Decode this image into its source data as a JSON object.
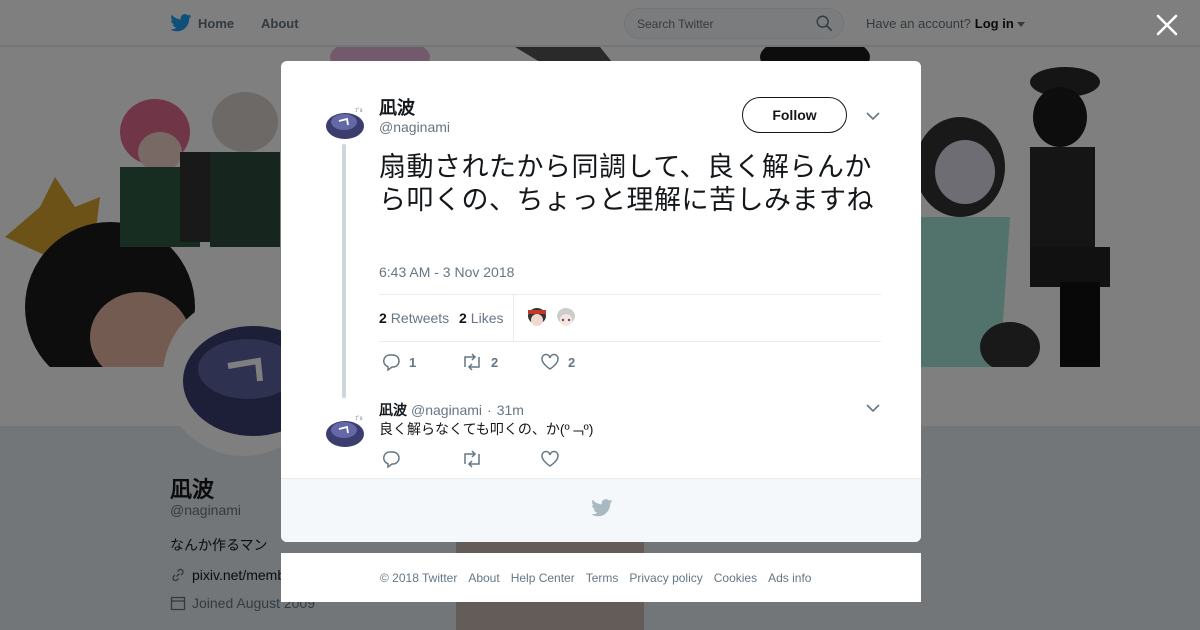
{
  "topbar": {
    "home_label": "Home",
    "about_label": "About",
    "search_placeholder": "Search Twitter",
    "account_prompt": "Have an account?",
    "login_label": "Log in"
  },
  "profile": {
    "name": "凪波",
    "handle": "@naginami",
    "bio": "なんか作るマン",
    "link": "pixiv.net/memb",
    "joined": "Joined August 2009"
  },
  "tweet": {
    "name": "凪波",
    "handle": "@naginami",
    "follow_label": "Follow",
    "text": "扇動されたから同調して、良く解らんから叩くの、ちょっと理解に苦しみますね",
    "timestamp": "6:43 AM - 3 Nov 2018",
    "retweets_count": "2",
    "retweets_label": "Retweets",
    "likes_count": "2",
    "likes_label": "Likes",
    "reply_count": "1",
    "retweet_count": "2",
    "like_count": "2"
  },
  "reply": {
    "name": "凪波",
    "handle": "@naginami",
    "dot": "·",
    "time": "31m",
    "text": "良く解らなくても叩くの、か(º﹁º)"
  },
  "footer": {
    "copyright": "© 2018 Twitter",
    "links": [
      "About",
      "Help Center",
      "Terms",
      "Privacy policy",
      "Cookies",
      "Ads info"
    ]
  },
  "colors": {
    "twitter_blue": "#1da1f2",
    "text_secondary": "#657786",
    "overlay": "rgba(0,0,0,0.5)"
  }
}
